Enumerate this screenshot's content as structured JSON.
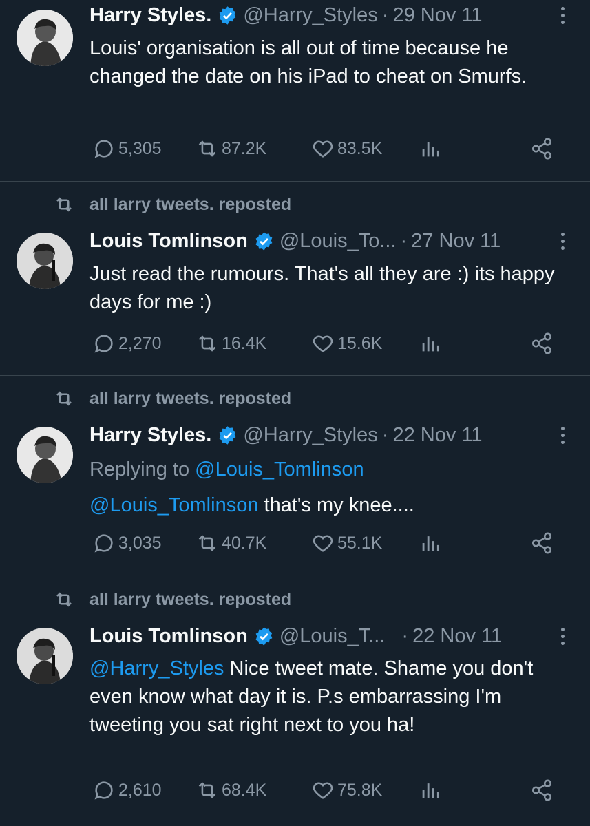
{
  "tweets": [
    {
      "reposted_by": "",
      "name": "Harry Styles.",
      "handle": "@Harry_Styles",
      "date": "29 Nov 11",
      "replying_label": "",
      "replying_handle": "",
      "mention": "",
      "text": "Louis' organisation is all out of time because he changed the date on his iPad to cheat on Smurfs.",
      "replies": "5,305",
      "reposts": "87.2K",
      "likes": "83.5K"
    },
    {
      "reposted_by": "all larry tweets. reposted",
      "name": "Louis Tomlinson",
      "handle": "@Louis_To...",
      "date": "27 Nov 11",
      "replying_label": "",
      "replying_handle": "",
      "mention": "",
      "text": "Just read the rumours. That's all they are :) its happy days for me :)",
      "replies": "2,270",
      "reposts": "16.4K",
      "likes": "15.6K"
    },
    {
      "reposted_by": "all larry tweets. reposted",
      "name": "Harry Styles.",
      "handle": "@Harry_Styles",
      "date": "22 Nov 11",
      "replying_label": "Replying to",
      "replying_handle": "@Louis_Tomlinson",
      "mention": "@Louis_Tomlinson",
      "text": " that's my knee....",
      "replies": "3,035",
      "reposts": "40.7K",
      "likes": "55.1K"
    },
    {
      "reposted_by": "all larry tweets. reposted",
      "name": "Louis Tomlinson",
      "handle": "@Louis_T...",
      "date": "22 Nov 11",
      "replying_label": "",
      "replying_handle": "",
      "mention": "@Harry_Styles",
      "text": " Nice tweet mate. Shame you don't even know what day it is. P.s embarrassing I'm tweeting you sat right next to you ha!",
      "replies": "2,610",
      "reposts": "68.4K",
      "likes": "75.8K"
    }
  ],
  "icons": {
    "reply": "reply-icon",
    "repost": "repost-icon",
    "like": "heart-icon",
    "views": "views-icon",
    "share": "share-icon",
    "verified": "verified-badge-icon",
    "more": "more-icon"
  },
  "colors": {
    "background": "#15202b",
    "text": "#f7f9f9",
    "muted": "#8b98a5",
    "link": "#1d9bf0",
    "divider": "#38444d"
  }
}
